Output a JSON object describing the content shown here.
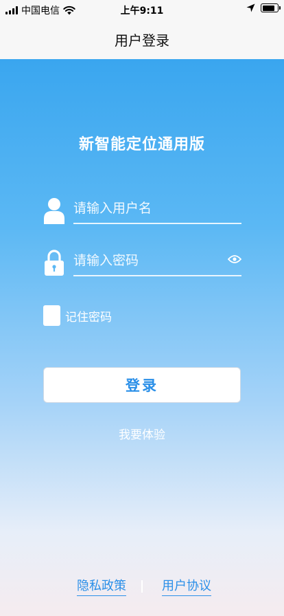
{
  "status_bar": {
    "carrier": "中国电信",
    "time": "上午9:11"
  },
  "nav": {
    "title": "用户登录"
  },
  "login": {
    "app_title": "新智能定位通用版",
    "username_placeholder": "请输入用户名",
    "password_placeholder": "请输入密码",
    "remember_label": "记住密码",
    "login_button": "登录",
    "trial_link": "我要体验"
  },
  "footer": {
    "privacy_policy": "隐私政策",
    "user_agreement": "用户协议"
  },
  "colors": {
    "accent": "#2a8fe8",
    "gradient_top": "#3aa6ef",
    "gradient_bottom": "#f5ecef"
  },
  "icons": {
    "username": "person-icon",
    "password": "lock-icon",
    "toggle_password": "eye-icon"
  }
}
